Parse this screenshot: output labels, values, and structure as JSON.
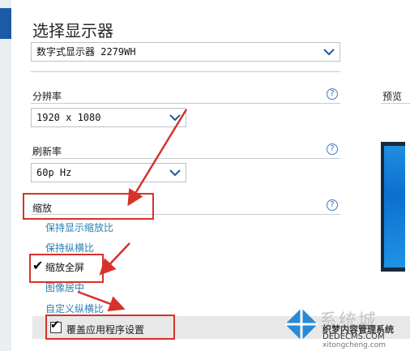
{
  "title": "选择显示器",
  "display_select": {
    "value": "数字式显示器 2279WH"
  },
  "resolution": {
    "label": "分辨率",
    "value": "1920 x 1080"
  },
  "refresh": {
    "label": "刷新率",
    "value": "60p Hz"
  },
  "scaling": {
    "label": "缩放",
    "options": [
      "保持显示缩放比",
      "保持纵横比",
      "缩放全屏",
      "图像居中",
      "自定义纵横比"
    ],
    "selected": "缩放全屏",
    "override_label": "覆盖应用程序设置",
    "override_checked": true
  },
  "preview_label": "预览",
  "help_glyph": "?",
  "check_glyph": "✔",
  "watermark": {
    "brand_text": "系统城",
    "line1": "织梦内容管理系统",
    "line2": "DEDECMS.COM",
    "url": "xitongcheng.com"
  },
  "colors": {
    "accent": "#1c5aa6",
    "link": "#2b7fb0",
    "annotation": "#d6322b"
  }
}
